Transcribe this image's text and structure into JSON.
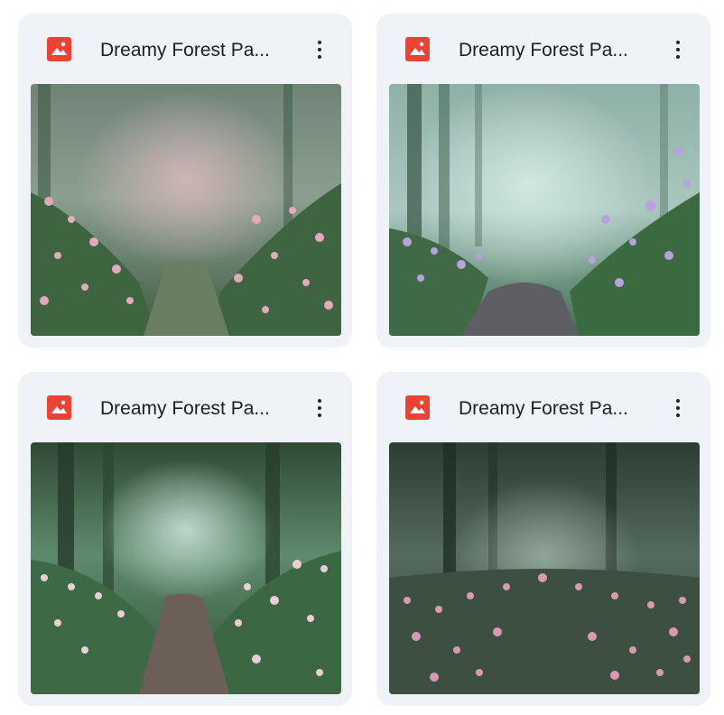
{
  "files": [
    {
      "name": "Dreamy Forest Pa...",
      "icon": "image-file-icon",
      "thumbnail": "misty forest path with pink flowers"
    },
    {
      "name": "Dreamy Forest Pa...",
      "icon": "image-file-icon",
      "thumbnail": "misty forest path with lavender flowers"
    },
    {
      "name": "Dreamy Forest Pa...",
      "icon": "image-file-icon",
      "thumbnail": "green forest path with white-pink blossoms"
    },
    {
      "name": "Dreamy Forest Pa...",
      "icon": "image-file-icon",
      "thumbnail": "dark forest path with pink flower carpet"
    }
  ],
  "colors": {
    "card_bg": "#eff2f6",
    "icon_red": "#ea4335",
    "text": "#1f1f1f"
  }
}
